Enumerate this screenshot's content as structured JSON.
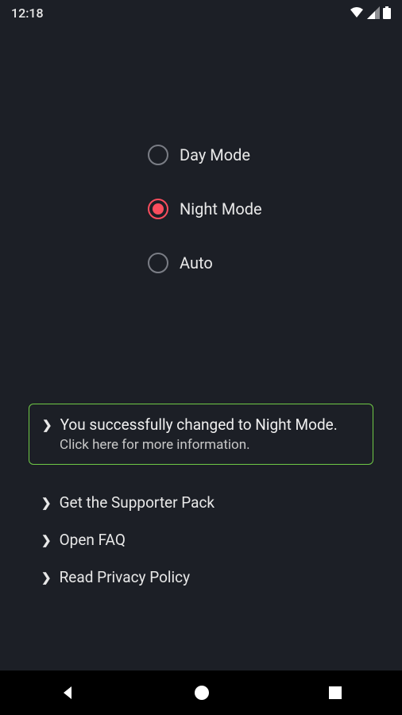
{
  "statusBar": {
    "time": "12:18"
  },
  "radioOptions": {
    "day": "Day Mode",
    "night": "Night Mode",
    "auto": "Auto"
  },
  "successMessage": {
    "title": "You successfully changed to Night Mode.",
    "subtitle": "Click here for more information."
  },
  "links": {
    "supporter": "Get the Supporter Pack",
    "faq": "Open FAQ",
    "privacy": "Read Privacy Policy"
  }
}
